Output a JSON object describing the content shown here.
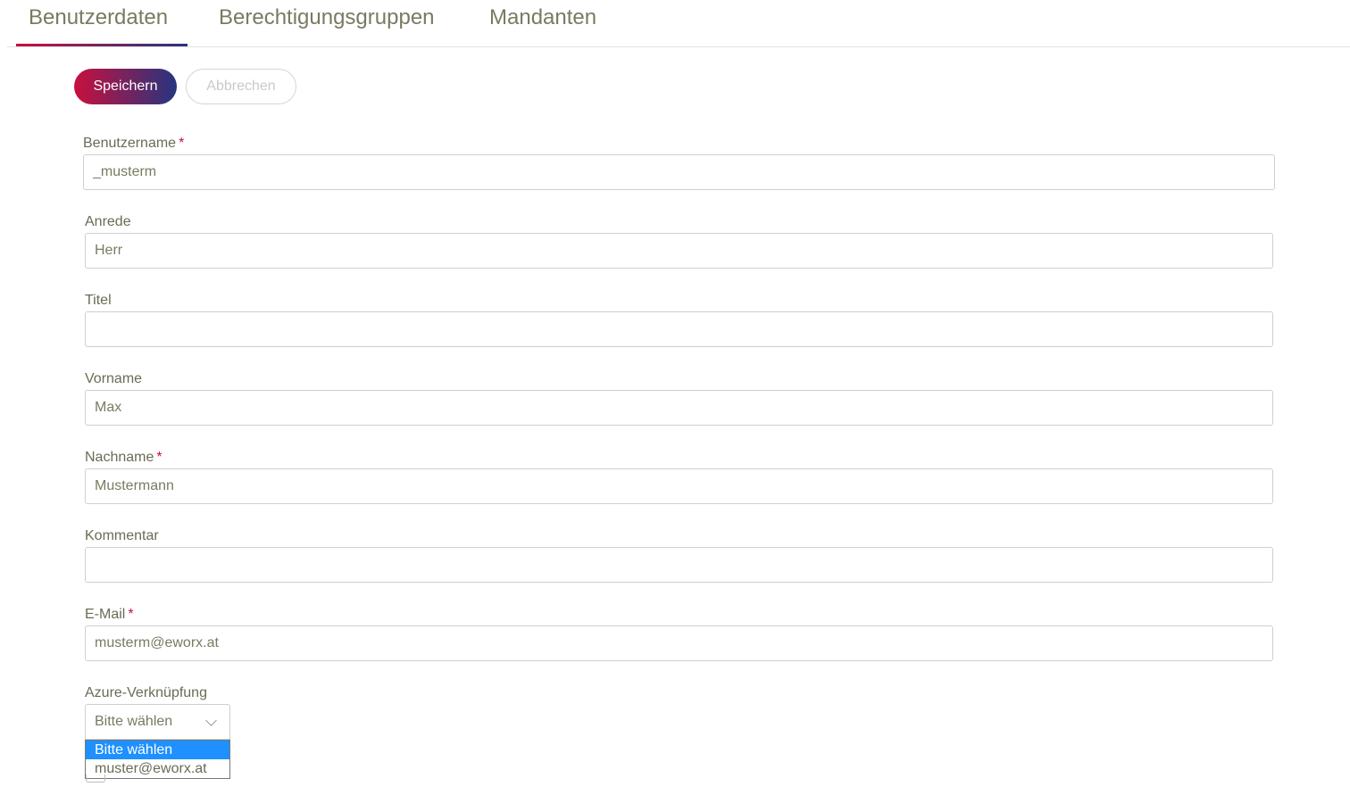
{
  "tabs": [
    {
      "label": "Benutzerdaten",
      "active": true
    },
    {
      "label": "Berechtigungsgruppen",
      "active": false
    },
    {
      "label": "Mandanten",
      "active": false
    }
  ],
  "toolbar": {
    "save_label": "Speichern",
    "cancel_label": "Abbrechen"
  },
  "colors": {
    "accent_start": "#c8103e",
    "accent_end": "#26357e",
    "required_marker": "#c8103e",
    "dropdown_highlight": "#1e90ff"
  },
  "form": {
    "username": {
      "label": "Benutzername",
      "required_mark": "*",
      "value": "_musterm"
    },
    "salutation": {
      "label": "Anrede",
      "value": "Herr"
    },
    "title": {
      "label": "Titel",
      "value": ""
    },
    "first_name": {
      "label": "Vorname",
      "value": "Max"
    },
    "last_name": {
      "label": "Nachname",
      "required_mark": "*",
      "value": "Mustermann"
    },
    "comment": {
      "label": "Kommentar",
      "value": ""
    },
    "email": {
      "label": "E-Mail",
      "required_mark": "*",
      "value": "musterm@eworx.at"
    },
    "azure": {
      "label": "Azure-Verknüpfung",
      "selected": "Bitte wählen",
      "options": [
        "Bitte wählen",
        "muster@eworx.at"
      ],
      "icon": "chevron-down-icon"
    }
  }
}
